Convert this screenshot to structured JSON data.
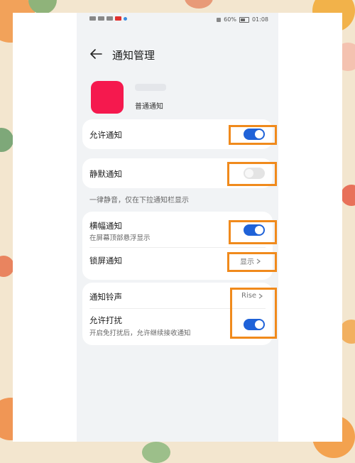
{
  "status_bar": {
    "battery": "60%",
    "time": "01:08"
  },
  "header": {
    "title": "通知管理"
  },
  "app": {
    "subtitle": "普通通知"
  },
  "settings": {
    "allow_notifications": {
      "label": "允许通知",
      "enabled": true
    },
    "silent_notifications": {
      "label": "静默通知",
      "enabled": false,
      "note": "一律静音，仅在下拉通知栏显示"
    },
    "banner_notifications": {
      "label": "横幅通知",
      "sub": "在屏幕顶部悬浮显示",
      "enabled": true
    },
    "lockscreen_notifications": {
      "label": "锁屏通知",
      "value": "显示"
    },
    "ringtone": {
      "label": "通知铃声",
      "value": "Rise"
    },
    "allow_interruptions": {
      "label": "允许打扰",
      "sub": "开启免打扰后，允许继续接收通知",
      "enabled": true
    }
  },
  "colors": {
    "toggle_on": "#1f62d8",
    "highlight": "#f08a1c",
    "app_icon": "#f5194e"
  }
}
